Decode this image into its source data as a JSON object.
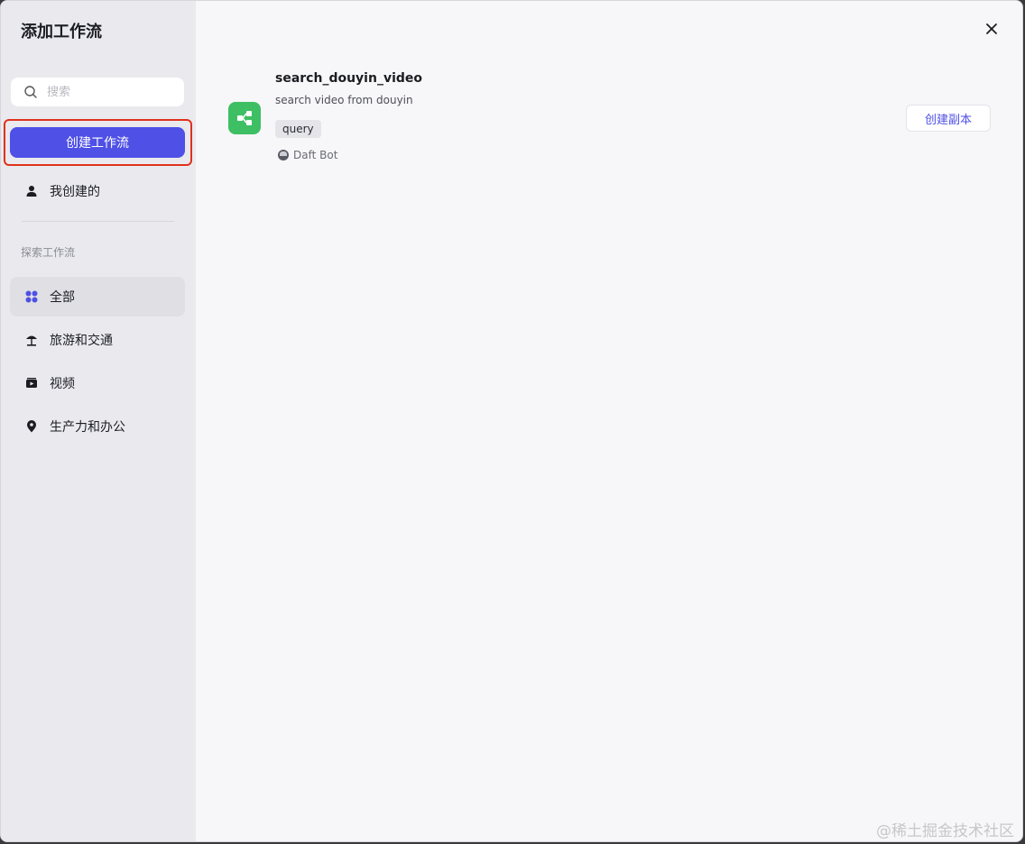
{
  "dialog": {
    "title": "添加工作流",
    "close_icon": "close-icon"
  },
  "sidebar": {
    "search": {
      "placeholder": "搜索",
      "icon": "search-icon"
    },
    "create_button": "创建工作流",
    "my_created": {
      "label": "我创建的",
      "icon": "user-icon"
    },
    "section_label": "探索工作流",
    "categories": [
      {
        "label": "全部",
        "icon": "grid-icon",
        "active": true
      },
      {
        "label": "旅游和交通",
        "icon": "beach-umbrella-icon",
        "active": false
      },
      {
        "label": "视频",
        "icon": "video-icon",
        "active": false
      },
      {
        "label": "生产力和办公",
        "icon": "location-pin-icon",
        "active": false
      }
    ]
  },
  "workflow": {
    "name": "search_douyin_video",
    "description": "search video from douyin",
    "tag": "query",
    "author": "Daft Bot",
    "icon": "workflow-icon",
    "copy_button": "创建副本"
  },
  "watermark": "@稀土掘金技术社区",
  "colors": {
    "accent": "#4f50e6",
    "workflow_icon_bg": "#3ebf63",
    "highlight_frame": "#e0311d",
    "sidebar_bg": "#eaeaee"
  }
}
